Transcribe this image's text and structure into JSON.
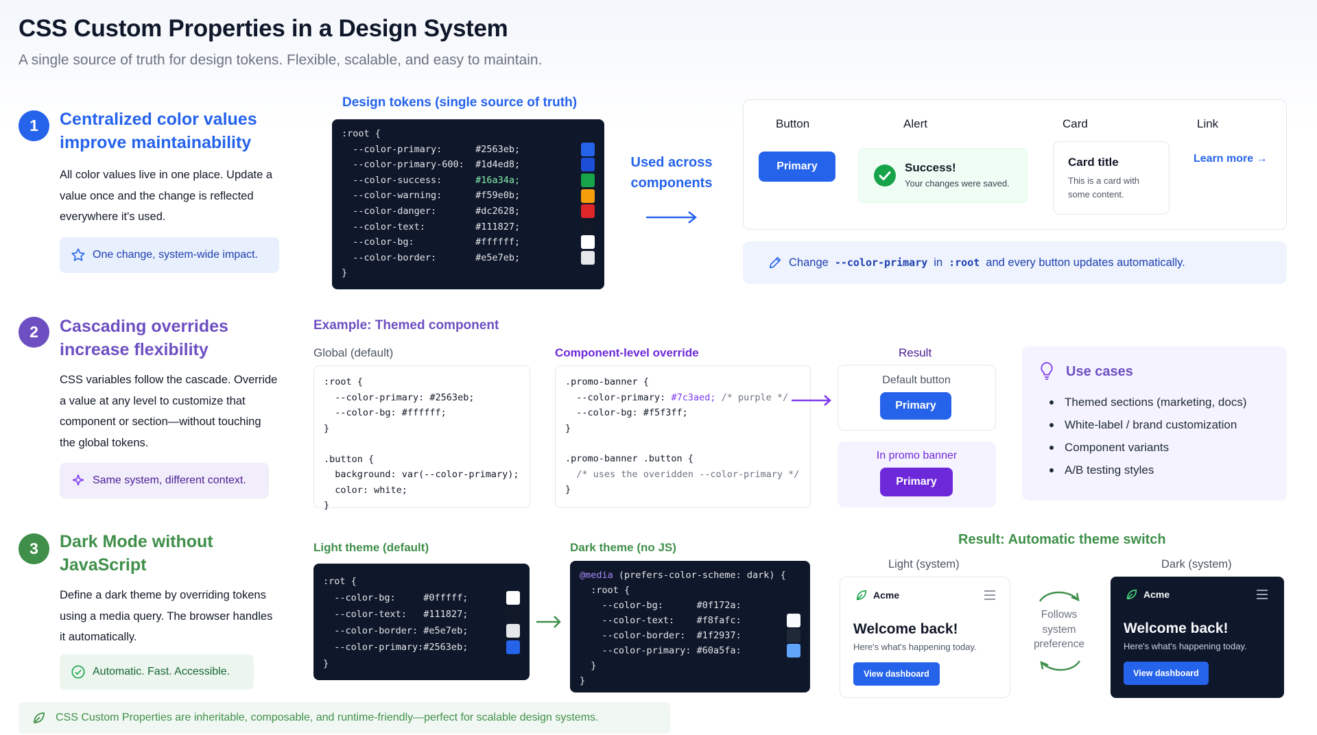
{
  "title": "CSS Custom Properties in a Design System",
  "subtitle": "A single source of truth for design tokens. Flexible, scalable, and easy to maintain.",
  "sections": [
    {
      "number": "1",
      "heading_1": "Centralized color values",
      "heading_2": "improve maintainability",
      "body_1": "All color values live in one place. Update a",
      "body_2": "value once and the change is reflected",
      "body_3": "everywhere it's used.",
      "pill": "One change, system-wide impact.",
      "color": "#2563eb"
    },
    {
      "number": "2",
      "heading_1": "Cascading overrides",
      "heading_2": "increase flexibility",
      "body_1": "CSS variables follow the cascade. Override",
      "body_2": "a value at any level to customize that",
      "body_3": "component or section—without touching",
      "body_4": "the global tokens.",
      "pill": "Same system, different context.",
      "color": "#6d4fc2"
    },
    {
      "number": "3",
      "heading_1": "Dark Mode without",
      "heading_2": "JavaScript",
      "body_1": "Define a dark theme by overriding tokens",
      "body_2": "using a media query. The browser handles",
      "body_3": "it automatically.",
      "pill": "Automatic. Fast. Accessible.",
      "color": "#3f8f4a"
    }
  ],
  "tokens": {
    "label": "Design tokens (single source of truth)",
    "open": ":root {",
    "close": "}",
    "rows": [
      {
        "name": "  --color-primary:",
        "value": "#2563eb;",
        "color": "#2563eb"
      },
      {
        "name": "  --color-primary-600:",
        "value": "#1d4ed8;",
        "color": "#1d4ed8"
      },
      {
        "name": "  --color-success:",
        "value": "#16a34a;",
        "color": "#16a34a"
      },
      {
        "name": "  --color-warning:",
        "value": "#f59e0b;",
        "color": "#f59e0b"
      },
      {
        "name": "  --color-danger:",
        "value": "#dc2628;",
        "color": "#dc2628"
      },
      {
        "name": "  --color-text:",
        "value": "#111827;",
        "color": "#111827"
      },
      {
        "name": "  --color-bg:",
        "value": "#ffffff;",
        "color": "#ffffff"
      },
      {
        "name": "  --color-border:",
        "value": "#e5e7eb;",
        "color": "#e5e7eb"
      }
    ],
    "used_1": "Used across",
    "used_2": "components"
  },
  "components": {
    "button_label": "Button",
    "button_text": "Primary",
    "alert_label": "Alert",
    "alert_title": "Success!",
    "alert_text": "Your changes were saved.",
    "card_label": "Card",
    "card_title": "Card title",
    "card_text_1": "This is a card with",
    "card_text_2": "some content.",
    "link_label": "Link",
    "link_text": "Learn more →",
    "note_1": "Change",
    "note_code_1": "--color-primary",
    "note_2": "in",
    "note_code_2": ":root",
    "note_3": "and every button updates automatically."
  },
  "themed": {
    "label": "Example: Themed component",
    "global_label": "Global (default)",
    "global_code": ":root {\n  --color-primary: #2563eb;\n  --color-bg: #ffffff;\n}\n\n.button {\n  background: var(--color-primary);\n  color: white;\n}",
    "override_label": "Component-level override",
    "override_l1": ".promo-banner {",
    "override_l2a": "  --color-primary: ",
    "override_l2b": "#7c3aed;",
    "override_l2c": " /* purple */",
    "override_l3": "  --color-bg: #f5f3ff;",
    "override_l4": "}",
    "override_l5": ".promo-banner .button {",
    "override_l6": "  /* uses the overidden --color-primary */",
    "override_l7": "}",
    "result_label": "Result",
    "default_button": "Default button",
    "promo_banner": "In promo banner",
    "primary": "Primary"
  },
  "use_cases": {
    "title": "Use cases",
    "items": [
      "Themed sections (marketing, docs)",
      "White-label / brand customization",
      "Component variants",
      "A/B testing styles"
    ]
  },
  "dark": {
    "light_label": "Light theme (default)",
    "light_open": ":rot {",
    "light_rows": [
      {
        "name": "  --color-bg:",
        "value": "#0fffff;",
        "color": "#ffffff"
      },
      {
        "name": "  --color-text:",
        "value": "#111827;",
        "color": "#111827"
      },
      {
        "name": "  --color-border:",
        "value": "#e5e7eb;",
        "color": "#e5e7eb"
      },
      {
        "name": "  --color-primary:",
        "value": "#2563eb;",
        "color": "#2563eb"
      }
    ],
    "close": "}",
    "dark_label": "Dark theme (no JS)",
    "dark_media_kw": "@media",
    "dark_media_rest": " (prefers-color-scheme: dark) {",
    "dark_root": "  :root {",
    "dark_rows": [
      {
        "name": "    --color-bg:",
        "value": "#0f172a:",
        "color": "#0f172a"
      },
      {
        "name": "    --color-text:",
        "value": "#f8fafc:",
        "color": "#f8fafc"
      },
      {
        "name": "    --color-border:",
        "value": "#1f2937:",
        "color": "#1f2937"
      },
      {
        "name": "    --color-primary:",
        "value": "#60a5fa:",
        "color": "#60a5fa"
      }
    ],
    "dark_close_inner": "  }",
    "result_label": "Result: Automatic theme switch",
    "light_system": "Light (system)",
    "dark_system": "Dark (system)",
    "follows_1": "Follows",
    "follows_2": "system",
    "follows_3": "preference",
    "brand": "Acme",
    "welcome": "Welcome back!",
    "welcome_sub": "Here's what's happening today.",
    "cta": "View dashboard"
  },
  "footer": "CSS Custom Properties are inheritable, composable, and runtime-friendly—perfect for scalable design systems."
}
